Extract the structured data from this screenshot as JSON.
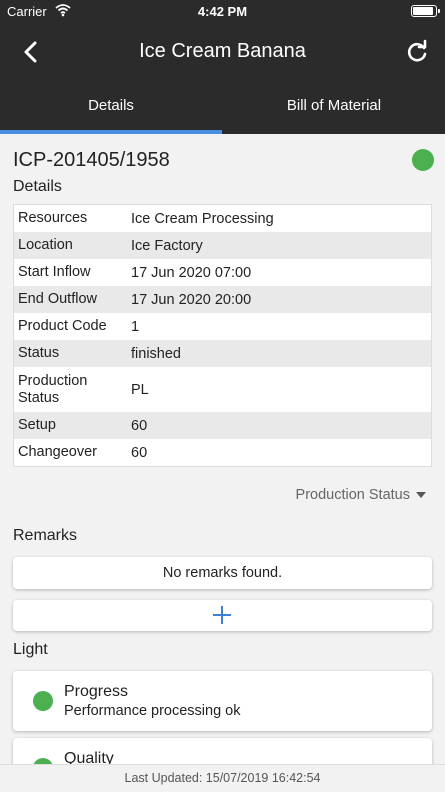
{
  "status_bar": {
    "carrier": "Carrier",
    "time": "4:42 PM",
    "wifi_icon": "wifi-icon",
    "battery_level": 0.9
  },
  "nav": {
    "title": "Ice Cream Banana",
    "back_icon": "chevron-left-icon",
    "refresh_icon": "refresh-icon"
  },
  "tabs": [
    {
      "label": "Details",
      "active": true
    },
    {
      "label": "Bill of Material",
      "active": false
    }
  ],
  "order": {
    "id": "ICP-201405/1958",
    "status_color": "#4caf50"
  },
  "details": {
    "heading": "Details",
    "rows": [
      {
        "key": "Resources",
        "value": "Ice Cream Processing"
      },
      {
        "key": "Location",
        "value": "Ice Factory"
      },
      {
        "key": "Start Inflow",
        "value": "17 Jun 2020 07:00"
      },
      {
        "key": "End Outflow",
        "value": "17 Jun 2020 20:00"
      },
      {
        "key": "Product Code",
        "value": "1"
      },
      {
        "key": "Status",
        "value": "finished"
      },
      {
        "key": "Production Status",
        "value": "PL"
      },
      {
        "key": "Setup",
        "value": "60"
      },
      {
        "key": "Changeover",
        "value": "60"
      }
    ]
  },
  "production_status_dropdown": {
    "label": "Production Status"
  },
  "remarks": {
    "heading": "Remarks",
    "empty_text": "No remarks found.",
    "add_icon": "plus-icon"
  },
  "light": {
    "heading": "Light",
    "items": [
      {
        "name": "Progress",
        "description": "Performance processing ok",
        "color": "#4caf50"
      },
      {
        "name": "Quality",
        "description": "",
        "color": "#4caf50"
      }
    ]
  },
  "footer": {
    "last_updated": "Last Updated: 15/07/2019 16:42:54"
  },
  "colors": {
    "header_bg": "#2b2b2b",
    "accent": "#4a90e2",
    "status_green": "#4caf50"
  }
}
